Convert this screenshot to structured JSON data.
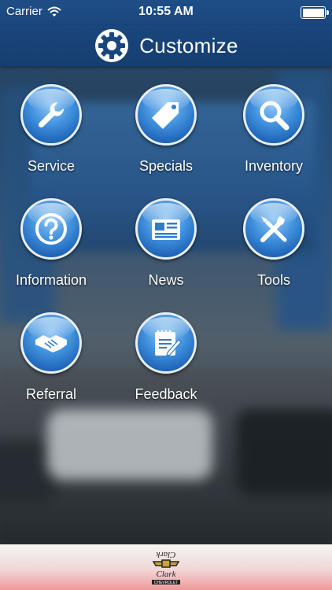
{
  "status_bar": {
    "carrier": "Carrier",
    "time": "10:55 AM"
  },
  "nav": {
    "title": "Customize",
    "icon": "gear-icon"
  },
  "menu": {
    "items": [
      {
        "label": "Service",
        "icon": "wrench-icon"
      },
      {
        "label": "Specials",
        "icon": "tag-icon"
      },
      {
        "label": "Inventory",
        "icon": "magnifier-icon"
      },
      {
        "label": "Information",
        "icon": "question-icon"
      },
      {
        "label": "News",
        "icon": "newspaper-icon"
      },
      {
        "label": "Tools",
        "icon": "tools-icon"
      },
      {
        "label": "Referral",
        "icon": "handshake-icon"
      },
      {
        "label": "Feedback",
        "icon": "feedback-icon"
      }
    ]
  },
  "footer": {
    "logo_text": "Clark Chevrolet",
    "logo_icon": "dealer-logo"
  },
  "colors": {
    "nav_bar": "#1a467d",
    "orb_blue": "#3f8fdc",
    "footer_tint": "#ef9a9a"
  }
}
